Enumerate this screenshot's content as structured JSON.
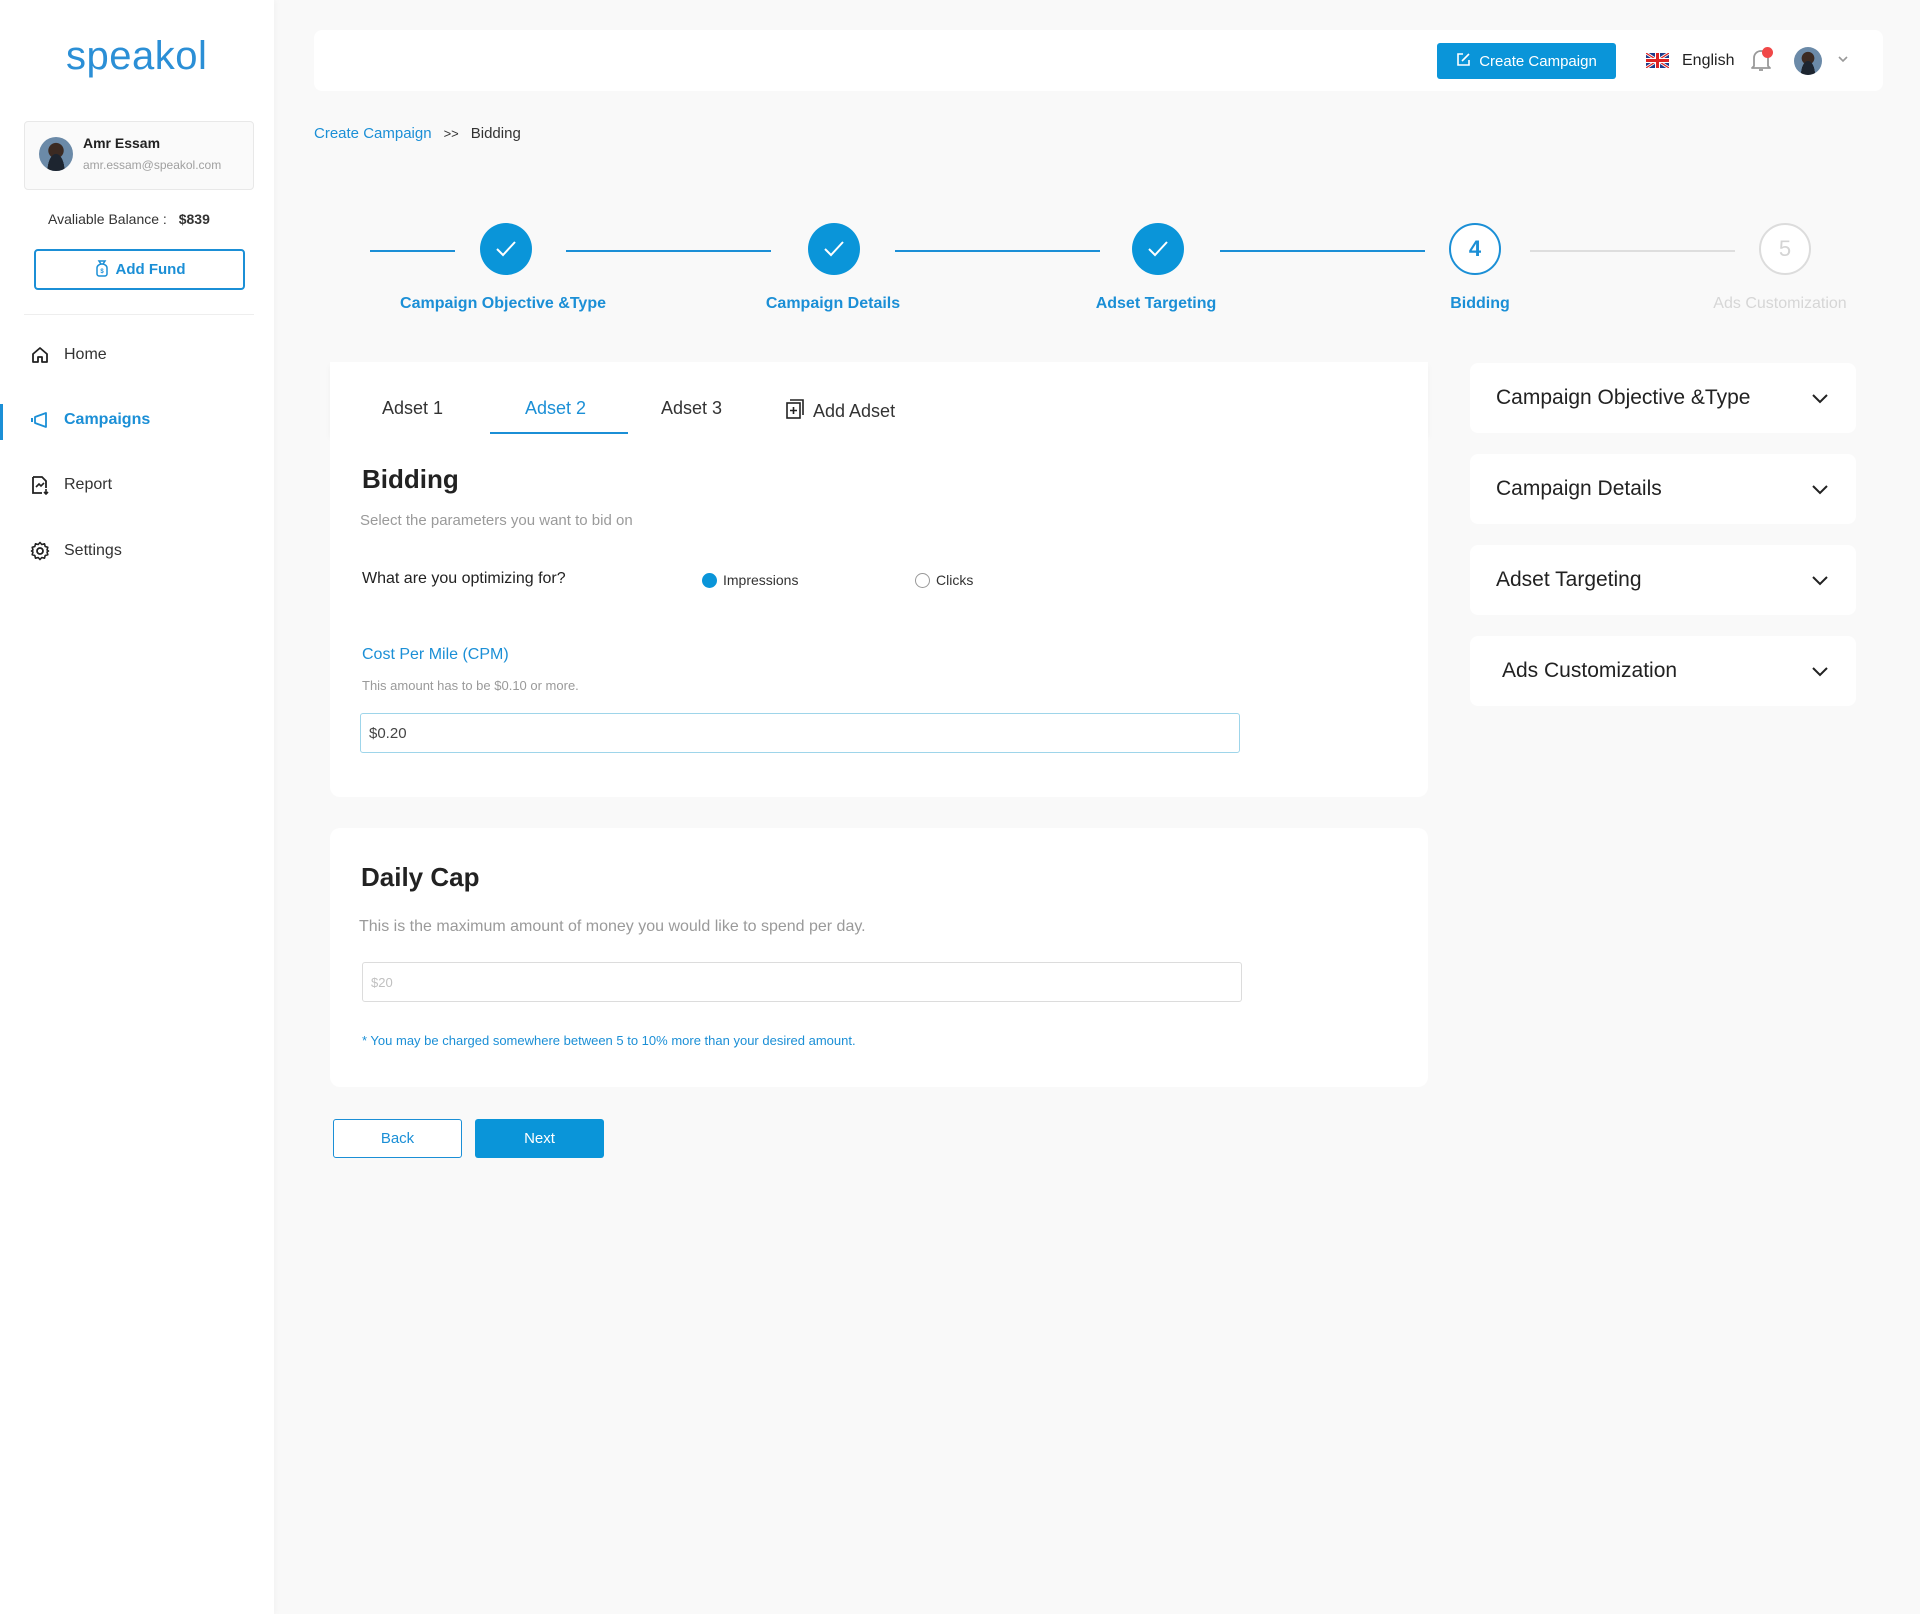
{
  "brand": {
    "logo": "speakol",
    "accent": "#0a95d9"
  },
  "user": {
    "name": "Amr Essam",
    "email": "amr.essam@speakol.com"
  },
  "balance": {
    "label": "Avaliable Balance :",
    "value": "$839"
  },
  "sidebar": {
    "add_fund": "Add Fund",
    "items": [
      {
        "label": "Home",
        "icon": "home-icon"
      },
      {
        "label": "Campaigns",
        "icon": "megaphone-icon",
        "active": true
      },
      {
        "label": "Report",
        "icon": "report-icon"
      },
      {
        "label": "Settings",
        "icon": "gear-icon"
      }
    ]
  },
  "header": {
    "create_campaign": "Create Campaign",
    "language": "English",
    "notification_dot_color": "#f04848"
  },
  "breadcrumb": {
    "parent": "Create Campaign",
    "separator": ">>",
    "current": "Bidding"
  },
  "stepper": {
    "steps": [
      {
        "label": "Campaign Objective &Type",
        "state": "done",
        "number": "1"
      },
      {
        "label": "Campaign Details",
        "state": "done",
        "number": "2"
      },
      {
        "label": "Adset Targeting",
        "state": "done",
        "number": "3"
      },
      {
        "label": "Bidding",
        "state": "current",
        "number": "4"
      },
      {
        "label": "Ads Customization",
        "state": "todo",
        "number": "5"
      }
    ]
  },
  "tabs": {
    "items": [
      "Adset 1",
      "Adset 2",
      "Adset 3"
    ],
    "active_index": 1,
    "add_label": "Add Adset"
  },
  "bidding": {
    "title": "Bidding",
    "subtitle": "Select the parameters you want to bid on",
    "question": "What are you optimizing for?",
    "options": [
      {
        "label": "Impressions",
        "checked": true
      },
      {
        "label": "Clicks",
        "checked": false
      }
    ],
    "cpm_label": "Cost Per Mile (CPM)",
    "cpm_hint": "This amount has to be $0.10 or more.",
    "cpm_value": "$0.20"
  },
  "daily_cap": {
    "title": "Daily Cap",
    "description": "This is the maximum amount of money you would like to spend per day.",
    "placeholder": "$20",
    "value": "",
    "note": "* You may be charged somewhere between 5 to 10% more than your desired amount."
  },
  "actions": {
    "back": "Back",
    "next": "Next"
  },
  "accordion": {
    "items": [
      "Campaign Objective &Type",
      "Campaign Details",
      "Adset Targeting",
      "Ads Customization"
    ]
  }
}
